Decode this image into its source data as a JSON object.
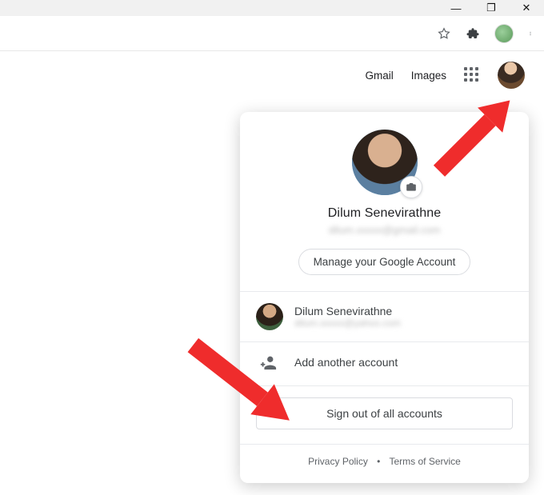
{
  "window": {
    "minimize_glyph": "—",
    "maximize_glyph": "❐",
    "close_glyph": "✕"
  },
  "browser_toolbar": {
    "star_tooltip": "Bookmark this tab",
    "extensions_tooltip": "Extensions",
    "profile_tooltip": "You",
    "menu_tooltip": "Customize and control Google Chrome"
  },
  "page_header": {
    "gmail_label": "Gmail",
    "images_label": "Images",
    "apps_tooltip": "Google apps",
    "account_tooltip": "Google Account"
  },
  "account_card": {
    "display_name": "Dilum Senevirathne",
    "email_masked": "dilum.xxxxx@gmail.com",
    "manage_label": "Manage your Google Account",
    "camera_tooltip": "Change profile photo",
    "other_accounts": [
      {
        "name": "Dilum Senevirathne",
        "email_masked": "dilum.xxxxx@yahoo.com"
      }
    ],
    "add_account_label": "Add another account",
    "sign_out_label": "Sign out of all accounts",
    "privacy_label": "Privacy Policy",
    "terms_label": "Terms of Service",
    "separator": "•"
  }
}
